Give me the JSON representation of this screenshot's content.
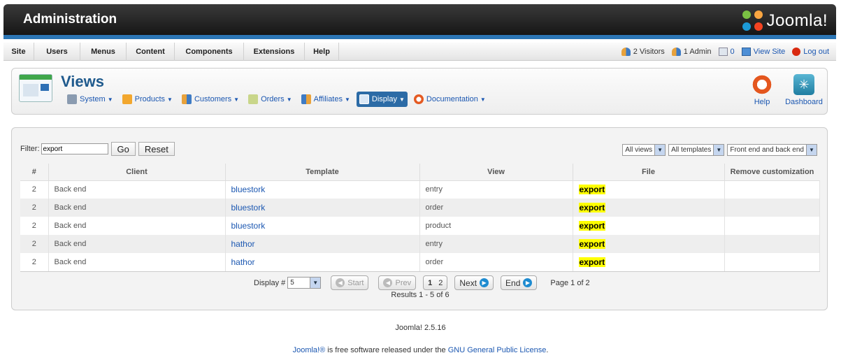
{
  "header": {
    "title": "Administration",
    "logo_text": "Joomla!",
    "stripe_color": "#2c76b5"
  },
  "menu": [
    "Site",
    "Users",
    "Menus",
    "Content",
    "Components",
    "Extensions",
    "Help"
  ],
  "status": {
    "visitors": "2 Visitors",
    "admins": "1 Admin",
    "messages": "0",
    "view_site": "View Site",
    "logout": "Log out"
  },
  "toolbar": {
    "page_title": "Views",
    "submenu": [
      "System",
      "Products",
      "Customers",
      "Orders",
      "Affiliates",
      "Display",
      "Documentation"
    ],
    "active_submenu": "Display",
    "help_label": "Help",
    "dashboard_label": "Dashboard"
  },
  "filter": {
    "label": "Filter:",
    "value": "export",
    "go_label": "Go",
    "reset_label": "Reset",
    "views_select": "All views",
    "templates_select": "All templates",
    "scope_select": "Front end and back end"
  },
  "table": {
    "columns": [
      "#",
      "Client",
      "Template",
      "View",
      "File",
      "Remove customization"
    ],
    "rows": [
      {
        "num": "2",
        "client": "Back end",
        "template": "bluestork",
        "view": "entry",
        "file": "export"
      },
      {
        "num": "2",
        "client": "Back end",
        "template": "bluestork",
        "view": "order",
        "file": "export"
      },
      {
        "num": "2",
        "client": "Back end",
        "template": "bluestork",
        "view": "product",
        "file": "export"
      },
      {
        "num": "2",
        "client": "Back end",
        "template": "hathor",
        "view": "entry",
        "file": "export"
      },
      {
        "num": "2",
        "client": "Back end",
        "template": "hathor",
        "view": "order",
        "file": "export"
      }
    ]
  },
  "pagination": {
    "display_label": "Display #",
    "display_value": "5",
    "start": "Start",
    "prev": "Prev",
    "page1": "1",
    "page2": "2",
    "next": "Next",
    "end": "End",
    "page_of": "Page 1 of 2",
    "results": "Results 1 - 5 of 6"
  },
  "footer": {
    "version": "Joomla! 2.5.16",
    "license_prefix": "Joomla!®",
    "license_middle": " is free software released under the ",
    "license_link": "GNU General Public License",
    "license_suffix": "."
  }
}
